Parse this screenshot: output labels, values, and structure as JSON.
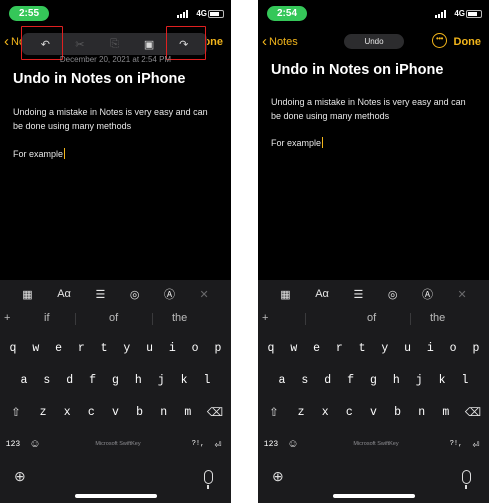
{
  "left": {
    "status": {
      "time": "2:55",
      "network": "4G"
    },
    "nav": {
      "back_label": "Notes",
      "done_label": "Done"
    },
    "edit_toolbar": {
      "undo_icon": "↶",
      "cut_icon": "✂",
      "copy_icon": "⎘",
      "paste_icon": "▣",
      "redo_icon": "↷"
    },
    "date": "December 20, 2021 at 2:54 PM",
    "note": {
      "title": "Undo in Notes on iPhone",
      "body": "Undoing a mistake in Notes is very easy and can be done using many methods",
      "example": "For example"
    }
  },
  "right": {
    "status": {
      "time": "2:54",
      "network": "4G"
    },
    "nav": {
      "back_label": "Notes",
      "undo_pill": "Undo",
      "more_icon": "•••",
      "done_label": "Done"
    },
    "note": {
      "title": "Undo in Notes on iPhone",
      "body": "Undoing a mistake in Notes is very easy and can be done using many methods",
      "example": "For example"
    }
  },
  "keyboard": {
    "format_bar": [
      "▦",
      "Aα",
      "☰",
      "◎",
      "Ⓐ",
      "✕"
    ],
    "suggestions": {
      "plus": "+",
      "items": [
        "if",
        "of",
        "the"
      ]
    },
    "rows": [
      [
        "q",
        "w",
        "e",
        "r",
        "t",
        "y",
        "u",
        "i",
        "o",
        "p"
      ],
      [
        "a",
        "s",
        "d",
        "f",
        "g",
        "h",
        "j",
        "k",
        "l"
      ],
      [
        "⇧",
        "z",
        "x",
        "c",
        "v",
        "b",
        "n",
        "m",
        "⌫"
      ],
      [
        "123",
        "☺",
        "?!,",
        "⏎"
      ]
    ],
    "space_label": "Microsoft SwiftKey",
    "globe_icon": "⊕"
  },
  "colors": {
    "accent": "#f2b51b",
    "time_pill": "#35c759",
    "highlight": "#e02020",
    "background": "#000000"
  }
}
